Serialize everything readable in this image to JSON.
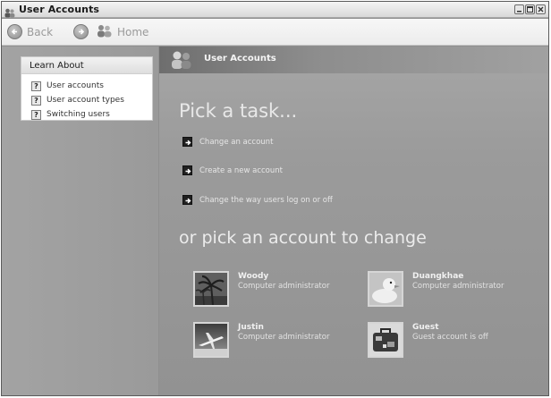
{
  "window": {
    "title": "User Accounts"
  },
  "toolbar": {
    "back_label": "Back",
    "home_label": "Home"
  },
  "learn_about": {
    "title": "Learn About",
    "items": [
      {
        "label": "User accounts",
        "icon": "help-icon"
      },
      {
        "label": "User account types",
        "icon": "help-icon"
      },
      {
        "label": "Switching users",
        "icon": "help-icon"
      }
    ]
  },
  "main": {
    "header_title": "User Accounts",
    "pick_task_heading": "Pick a task...",
    "tasks": [
      {
        "label": "Change an account"
      },
      {
        "label": "Create a new account"
      },
      {
        "label": "Change the way users log on or off"
      }
    ],
    "pick_account_heading": "or pick an account to change",
    "accounts": [
      {
        "name": "Woody",
        "description": "Computer administrator",
        "picture": "palm-tree"
      },
      {
        "name": "Duangkhae",
        "description": "Computer administrator",
        "picture": "rubber-duck"
      },
      {
        "name": "Justin",
        "description": "Computer administrator",
        "picture": "airplane"
      },
      {
        "name": "Guest",
        "description": "Guest account is off",
        "picture": "suitcase"
      }
    ]
  }
}
